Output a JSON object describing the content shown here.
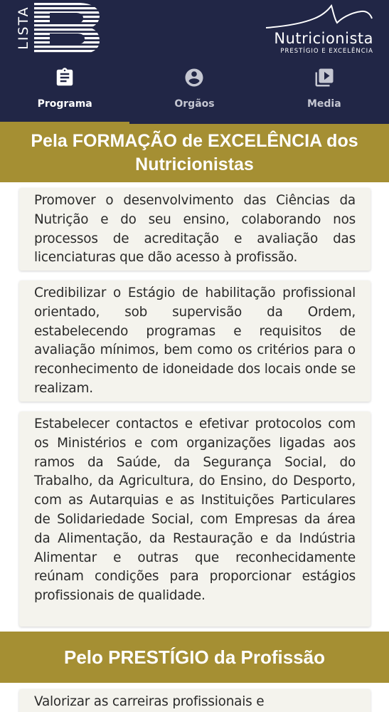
{
  "header": {
    "logo_left": {
      "vertical_text": "LISTA",
      "letter": "B"
    },
    "logo_right": {
      "name": "Nutricionista",
      "tagline": "PRESTÍGIO E EXCELÊNCIA"
    },
    "colors": {
      "background": "#212646",
      "accent": "#a58f33"
    }
  },
  "tabs": [
    {
      "label": "Programa",
      "icon": "clipboard-icon",
      "active": true
    },
    {
      "label": "Orgãos",
      "icon": "account-circle-icon",
      "active": false
    },
    {
      "label": "Media",
      "icon": "video-library-icon",
      "active": false
    }
  ],
  "sections": [
    {
      "title": "Pela FORMAÇÃO de EXCELÊNCIA dos Nutricionistas",
      "items": [
        "Promover o desenvolvimento das Ciências da Nutrição e do seu ensino, colaborando nos processos de acreditação e avaliação das licenciaturas que dão acesso à profissão.",
        "Credibilizar o Estágio de habilitação profissional orientado, sob supervisão da Ordem, estabelecendo programas e requisitos de avaliação mínimos, bem como os critérios para o reconhecimento de idoneidade dos locais onde se realizam.",
        "Estabelecer contactos e efetivar protocolos com os Ministérios e com organizações ligadas aos ramos da Saúde, da Segurança Social, do Trabalho, da Agricultura, do Ensino, do Desporto, com as Autarquias e as Instituições Particulares de Solidariedade Social, com Empresas da área da Alimentação, da Restauração e da Indústria Alimentar e outras que reconhecidamente reúnam condições para proporcionar estágios profissionais de qualidade."
      ]
    },
    {
      "title": "Pelo PRESTÍGIO da Profissão",
      "items": [
        "Valorizar as carreiras profissionais e"
      ]
    }
  ]
}
